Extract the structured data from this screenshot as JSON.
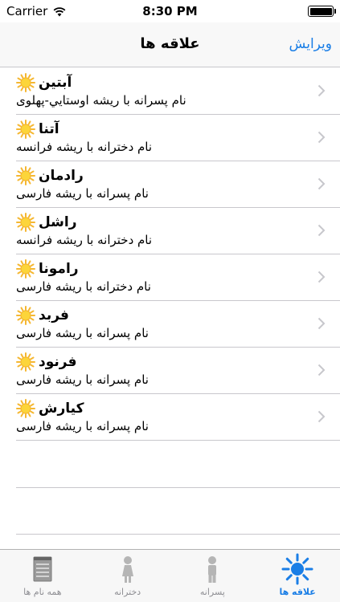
{
  "status_bar": {
    "carrier": "Carrier",
    "time": "8:30 PM"
  },
  "nav": {
    "title": "علاقه ها",
    "edit_label": "ویرایش"
  },
  "list": {
    "items": [
      {
        "name": "آبتین",
        "description": "نام پسرانه با ریشه اوستایي-پهلوی"
      },
      {
        "name": "آتنا",
        "description": "نام دخترانه با ریشه فرانسه"
      },
      {
        "name": "رادمان",
        "description": "نام پسرانه با ریشه فارسی"
      },
      {
        "name": "راشل",
        "description": "نام دخترانه با ریشه فرانسه"
      },
      {
        "name": "رامونا",
        "description": "نام دخترانه با ریشه فارسی"
      },
      {
        "name": "فربد",
        "description": "نام پسرانه با ریشه فارسی"
      },
      {
        "name": "فرنود",
        "description": "نام پسرانه با ریشه فارسی"
      },
      {
        "name": "کیارش",
        "description": "نام پسرانه با ریشه فارسی"
      }
    ]
  },
  "tab_bar": {
    "tabs": [
      {
        "label": "همه نام ها",
        "icon": "notepad-icon",
        "active": false
      },
      {
        "label": "دخترانه",
        "icon": "girl-icon",
        "active": false
      },
      {
        "label": "پسرانه",
        "icon": "boy-icon",
        "active": false
      },
      {
        "label": "علاقه ها",
        "icon": "sun-icon",
        "active": true
      }
    ]
  },
  "colors": {
    "accent": "#1a7ee6",
    "sun": "#f5b731",
    "separator": "#c8c7cc"
  }
}
